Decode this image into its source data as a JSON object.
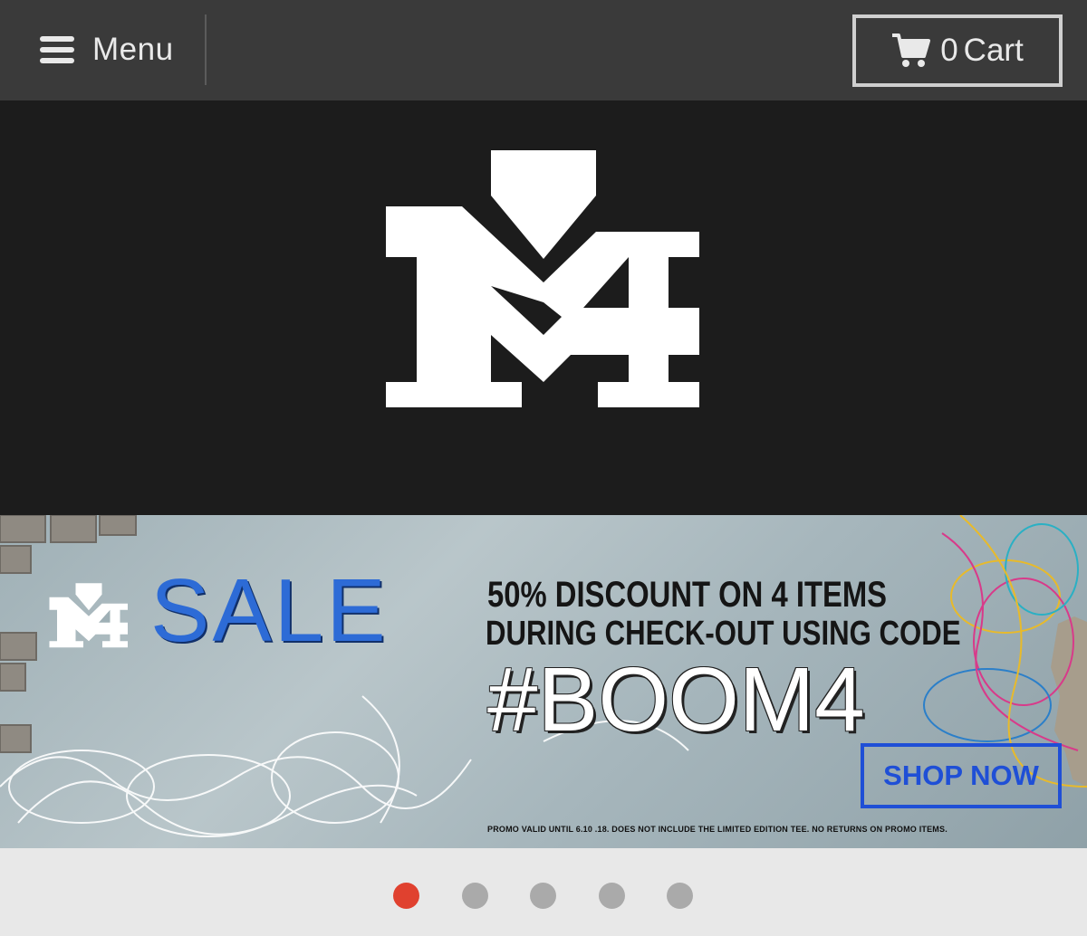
{
  "header": {
    "menu_label": "Menu",
    "cart_count": "0",
    "cart_label": "Cart"
  },
  "banner": {
    "sale_word": "SALE",
    "promo_line1": "50% DISCOUNT ON 4 ITEMS",
    "promo_line2": "DURING CHECK-OUT USING CODE",
    "promo_code": "#BOOM4",
    "cta_label": "SHOP NOW",
    "fine_print": "PROMO VALID UNTIL 6.10 .18.  DOES NOT INCLUDE THE LIMITED EDITION TEE. NO RETURNS ON PROMO ITEMS."
  },
  "slider": {
    "slide_count": 5,
    "active_index": 0
  },
  "colors": {
    "topbar_bg": "#3a3a3a",
    "logo_bg": "#1c1c1c",
    "sale_blue": "#2d6bd6",
    "cta_blue": "#1f4fd6",
    "active_dot": "#e0412f",
    "inactive_dot": "#aaaaaa"
  },
  "icons": {
    "menu": "hamburger-icon",
    "cart": "shopping-cart-icon",
    "logo": "m4-logo"
  }
}
